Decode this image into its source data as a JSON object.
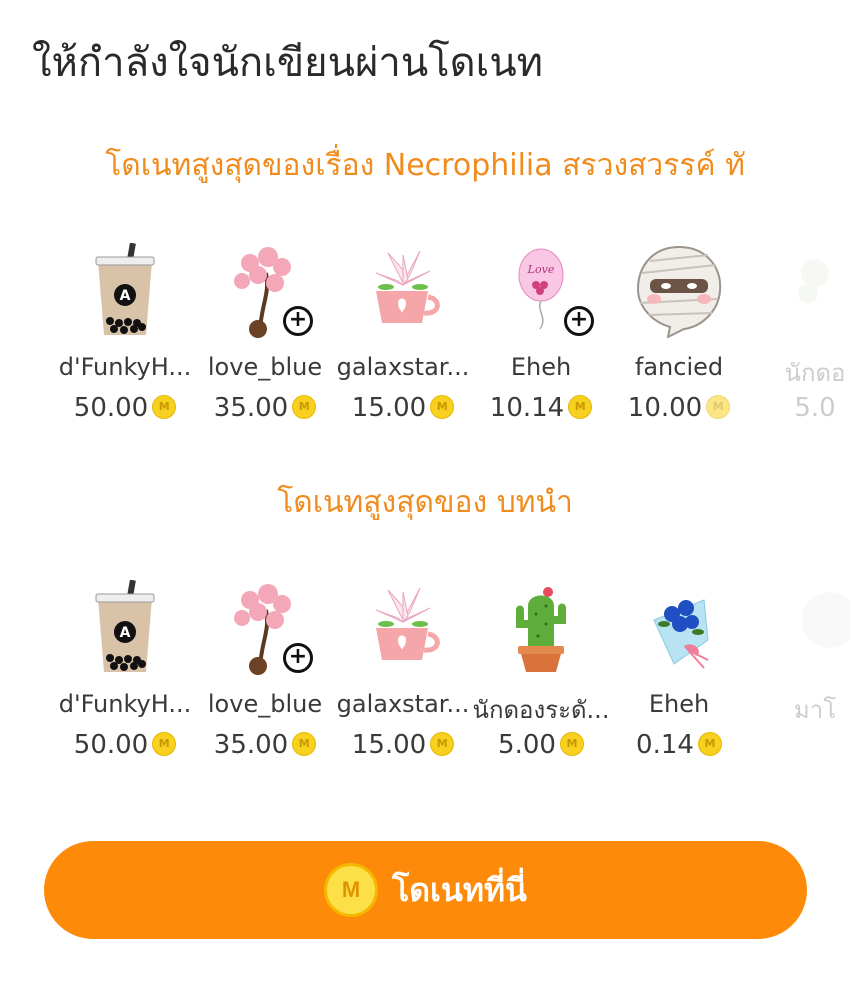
{
  "header": {
    "title": "ให้กำลังใจนักเขียนผ่านโดเนท"
  },
  "sections": [
    {
      "title": "โดเนทสูงสุดของเรื่อง Necrophilia สรวงสวรรค์ ทั",
      "donors": [
        {
          "name": "d'FunkyH...",
          "amount": "50.00",
          "gift_icon": "bubble-tea-icon"
        },
        {
          "name": "love_blue",
          "amount": "35.00",
          "gift_icon": "cherry-blossom-bonsai-icon"
        },
        {
          "name": "galaxstar...",
          "amount": "15.00",
          "gift_icon": "lily-teacup-icon"
        },
        {
          "name": "Eheh",
          "amount": "10.14",
          "gift_icon": "love-balloon-icon"
        },
        {
          "name": "fancied",
          "amount": "10.00",
          "gift_icon": "mummy-face-icon"
        },
        {
          "name": "นักดอ",
          "amount": "5.0",
          "gift_icon": "flower-icon"
        }
      ]
    },
    {
      "title": "โดเนทสูงสุดของ บทนำ",
      "donors": [
        {
          "name": "d'FunkyH...",
          "amount": "50.00",
          "gift_icon": "bubble-tea-icon"
        },
        {
          "name": "love_blue",
          "amount": "35.00",
          "gift_icon": "cherry-blossom-bonsai-icon"
        },
        {
          "name": "galaxstar...",
          "amount": "15.00",
          "gift_icon": "lily-teacup-icon"
        },
        {
          "name": "นักดองระดั...",
          "amount": "5.00",
          "gift_icon": "cactus-icon"
        },
        {
          "name": "Eheh",
          "amount": "0.14",
          "gift_icon": "blue-rose-bouquet-icon"
        },
        {
          "name": "มาโ",
          "amount": "",
          "gift_icon": "plant-icon"
        }
      ]
    }
  ],
  "coin_symbol": "M",
  "donate_button": {
    "label": "โดเนทที่นี่",
    "coin_symbol": "M"
  },
  "colors": {
    "accent": "#fd8a08",
    "section_title": "#f08c1e",
    "coin": "#f8d020"
  }
}
